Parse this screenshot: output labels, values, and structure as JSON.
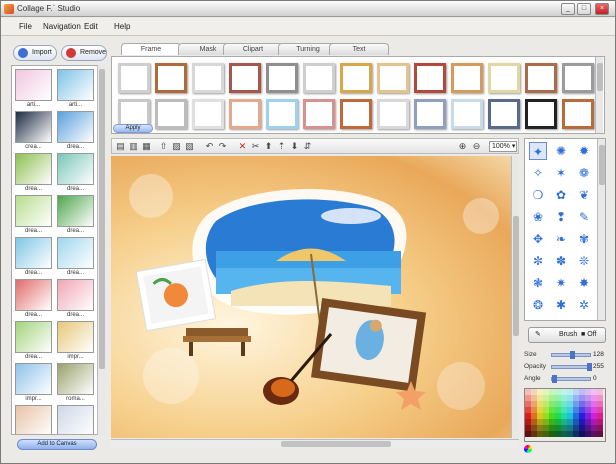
{
  "window": {
    "title": "Collage F.` Studio"
  },
  "menu": [
    {
      "label": "File"
    },
    {
      "label": "Navigation"
    },
    {
      "label": "Edit"
    },
    {
      "label": "Help"
    }
  ],
  "left_panel": {
    "import_label": "Import",
    "remove_label": "Remove",
    "add_label": "Add to Canvas",
    "thumbnails": [
      {
        "caption": "arti...",
        "color": "#f2c6df"
      },
      {
        "caption": "arti...",
        "color": "#7fc3e8"
      },
      {
        "caption": "crea...",
        "color": "#1d2b44"
      },
      {
        "caption": "drea...",
        "color": "#5aa0de"
      },
      {
        "caption": "drea...",
        "color": "#8fbf4f"
      },
      {
        "caption": "drea...",
        "color": "#79c7b9"
      },
      {
        "caption": "drea...",
        "color": "#b7dd8e"
      },
      {
        "caption": "drea...",
        "color": "#4fa54f"
      },
      {
        "caption": "drea...",
        "color": "#7ec6e6"
      },
      {
        "caption": "drea...",
        "color": "#9fd6ee"
      },
      {
        "caption": "drea...",
        "color": "#e26b6b"
      },
      {
        "caption": "drea...",
        "color": "#f0a6b6"
      },
      {
        "caption": "drea...",
        "color": "#a3d37b"
      },
      {
        "caption": "impr...",
        "color": "#e7c779"
      },
      {
        "caption": "impr...",
        "color": "#8ec2e9"
      },
      {
        "caption": "roma...",
        "color": "#9aa26d"
      },
      {
        "caption": "",
        "color": "#e8c3a7"
      },
      {
        "caption": "",
        "color": "#cfd7e8"
      }
    ]
  },
  "tabs": [
    {
      "label": "Frame"
    },
    {
      "label": "Mask"
    },
    {
      "label": "Clipart"
    },
    {
      "label": "Turning"
    },
    {
      "label": "Text"
    }
  ],
  "frames_apply_label": "Apply",
  "frame_colors": [
    "#cfcfcf",
    "#b06a3a",
    "#d8d8d8",
    "#a7574a",
    "#8f8f8f",
    "#cfcfcf",
    "#d9a64a",
    "#e2c48c",
    "#b14a3a",
    "#d69a5a",
    "#e0d8a0",
    "#ac6a4a",
    "#9b9b9b",
    "#c8c8c8",
    "#bcbcbc",
    "#e0e0e0",
    "#e6a88c",
    "#9ed0f0",
    "#d99090",
    "#c06a3a",
    "#d8d8d8",
    "#8f9fc0",
    "#c9dbe8",
    "#5a6a8a",
    "#222222",
    "#b86a3a"
  ],
  "toolbar": {
    "zoom": "100%"
  },
  "brushes": {
    "button_label": "Brush",
    "off_label": "Off",
    "glyphs": [
      "✦",
      "✺",
      "✹",
      "✧",
      "✶",
      "❁",
      "❍",
      "✿",
      "❦",
      "❀",
      "❢",
      "✎",
      "✥",
      "❧",
      "✾",
      "✼",
      "✽",
      "❊",
      "❃",
      "✷",
      "✸",
      "❂",
      "✱",
      "✲"
    ]
  },
  "params": [
    {
      "label": "Size",
      "value": "128",
      "level": 0.5
    },
    {
      "label": "Opacity",
      "value": "255",
      "level": 1.0
    },
    {
      "label": "Angle",
      "value": "0",
      "level": 0.0
    }
  ]
}
